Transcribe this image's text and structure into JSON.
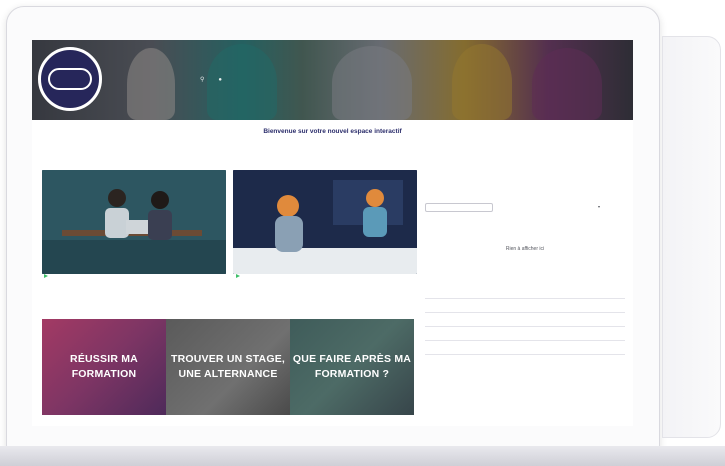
{
  "welcome": {
    "title": "Bienvenue sur votre nouvel espace interactif",
    "text": ""
  },
  "colors": {
    "brand_navy": "#26265a",
    "title_navy": "#2b2d6b",
    "green_link": "#2e9a5e"
  },
  "icons": [
    "search-icon",
    "user-icon",
    "play-icon"
  ],
  "tiles": [
    {
      "label": "RÉUSSIR MA FORMATION"
    },
    {
      "label": "TROUVER UN STAGE, UNE ALTERNANCE"
    },
    {
      "label": "QUE FAIRE APRÈS MA FORMATION ?"
    }
  ],
  "sidebar": {
    "empty_title": "Rien à afficher ici"
  }
}
